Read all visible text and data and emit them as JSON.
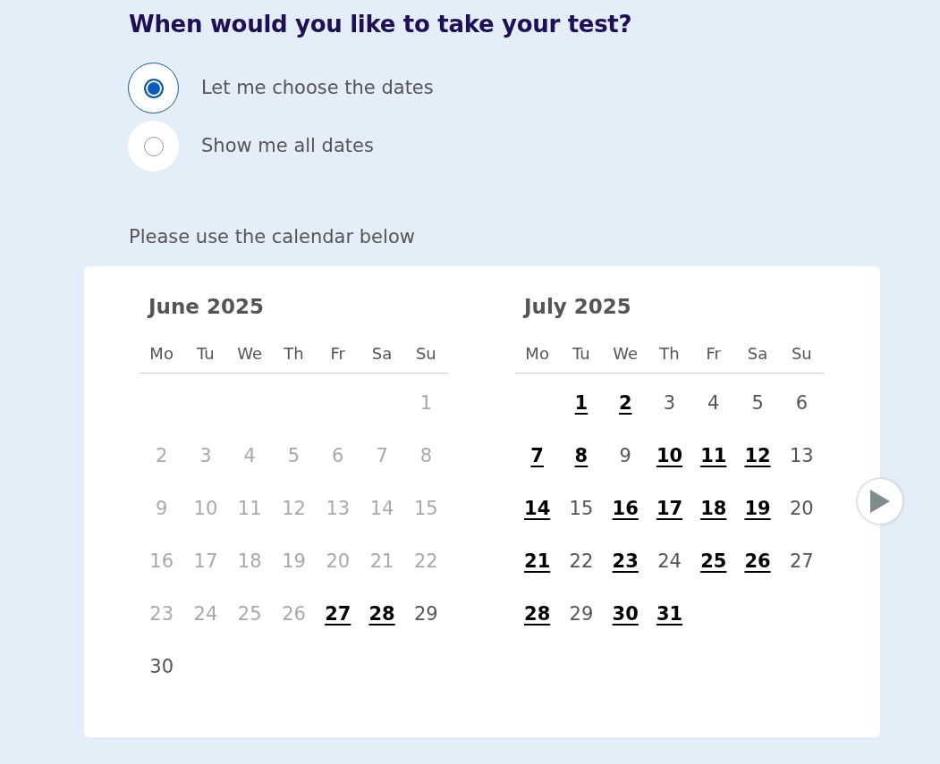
{
  "title": "When would you like to take your test?",
  "options": [
    {
      "label": "Let me choose the dates",
      "selected": true
    },
    {
      "label": "Show me all dates",
      "selected": false
    }
  ],
  "instruction": "Please use the calendar below",
  "calendar": {
    "months": [
      {
        "title": "June 2025",
        "weekdays": [
          "Mo",
          "Tu",
          "We",
          "Th",
          "Fr",
          "Sa",
          "Su"
        ],
        "weeks": [
          [
            {
              "kind": "blank"
            },
            {
              "kind": "blank"
            },
            {
              "kind": "blank"
            },
            {
              "kind": "blank"
            },
            {
              "kind": "blank"
            },
            {
              "kind": "blank"
            },
            {
              "day": "1",
              "kind": "past"
            }
          ],
          [
            {
              "day": "2",
              "kind": "past"
            },
            {
              "day": "3",
              "kind": "past"
            },
            {
              "day": "4",
              "kind": "past"
            },
            {
              "day": "5",
              "kind": "past"
            },
            {
              "day": "6",
              "kind": "past"
            },
            {
              "day": "7",
              "kind": "past"
            },
            {
              "day": "8",
              "kind": "past"
            }
          ],
          [
            {
              "day": "9",
              "kind": "past"
            },
            {
              "day": "10",
              "kind": "past"
            },
            {
              "day": "11",
              "kind": "past"
            },
            {
              "day": "12",
              "kind": "past"
            },
            {
              "day": "13",
              "kind": "past"
            },
            {
              "day": "14",
              "kind": "past"
            },
            {
              "day": "15",
              "kind": "past"
            }
          ],
          [
            {
              "day": "16",
              "kind": "past"
            },
            {
              "day": "17",
              "kind": "past"
            },
            {
              "day": "18",
              "kind": "past"
            },
            {
              "day": "19",
              "kind": "past"
            },
            {
              "day": "20",
              "kind": "past"
            },
            {
              "day": "21",
              "kind": "past"
            },
            {
              "day": "22",
              "kind": "past"
            }
          ],
          [
            {
              "day": "23",
              "kind": "past"
            },
            {
              "day": "24",
              "kind": "past"
            },
            {
              "day": "25",
              "kind": "past"
            },
            {
              "day": "26",
              "kind": "past"
            },
            {
              "day": "27",
              "kind": "available"
            },
            {
              "day": "28",
              "kind": "available"
            },
            {
              "day": "29",
              "kind": "unavailable"
            }
          ],
          [
            {
              "day": "30",
              "kind": "unavailable"
            }
          ]
        ]
      },
      {
        "title": "July 2025",
        "weekdays": [
          "Mo",
          "Tu",
          "We",
          "Th",
          "Fr",
          "Sa",
          "Su"
        ],
        "weeks": [
          [
            {
              "kind": "blank"
            },
            {
              "day": "1",
              "kind": "available"
            },
            {
              "day": "2",
              "kind": "available"
            },
            {
              "day": "3",
              "kind": "unavailable"
            },
            {
              "day": "4",
              "kind": "unavailable"
            },
            {
              "day": "5",
              "kind": "unavailable"
            },
            {
              "day": "6",
              "kind": "unavailable"
            }
          ],
          [
            {
              "day": "7",
              "kind": "available"
            },
            {
              "day": "8",
              "kind": "available"
            },
            {
              "day": "9",
              "kind": "unavailable"
            },
            {
              "day": "10",
              "kind": "available"
            },
            {
              "day": "11",
              "kind": "available"
            },
            {
              "day": "12",
              "kind": "available"
            },
            {
              "day": "13",
              "kind": "unavailable"
            }
          ],
          [
            {
              "day": "14",
              "kind": "available"
            },
            {
              "day": "15",
              "kind": "unavailable"
            },
            {
              "day": "16",
              "kind": "available"
            },
            {
              "day": "17",
              "kind": "available"
            },
            {
              "day": "18",
              "kind": "available"
            },
            {
              "day": "19",
              "kind": "available"
            },
            {
              "day": "20",
              "kind": "unavailable"
            }
          ],
          [
            {
              "day": "21",
              "kind": "available"
            },
            {
              "day": "22",
              "kind": "unavailable"
            },
            {
              "day": "23",
              "kind": "available"
            },
            {
              "day": "24",
              "kind": "unavailable"
            },
            {
              "day": "25",
              "kind": "available"
            },
            {
              "day": "26",
              "kind": "available"
            },
            {
              "day": "27",
              "kind": "unavailable"
            }
          ],
          [
            {
              "day": "28",
              "kind": "available"
            },
            {
              "day": "29",
              "kind": "unavailable"
            },
            {
              "day": "30",
              "kind": "available"
            },
            {
              "day": "31",
              "kind": "available"
            }
          ]
        ]
      }
    ]
  }
}
